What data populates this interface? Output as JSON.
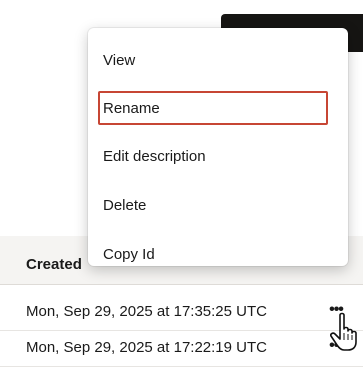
{
  "table": {
    "column_created": "Created",
    "rows": [
      {
        "created": "Mon, Sep 29, 2025 at 17:35:25 UTC",
        "more": "•••"
      },
      {
        "created": "Mon, Sep 29, 2025 at 17:22:19 UTC",
        "more": "•••"
      }
    ]
  },
  "context_menu": {
    "items": [
      {
        "label": "View"
      },
      {
        "label": "Rename",
        "focused": true
      },
      {
        "label": "Edit description"
      },
      {
        "label": "Delete"
      },
      {
        "label": "Copy Id"
      }
    ]
  },
  "icons": {
    "cursor": "hand-pointer-icon",
    "row_actions": "more-actions-icon"
  },
  "colors": {
    "focus_ring": "#c74634",
    "top_bar": "#161513",
    "header_bg": "#f5f4f2"
  }
}
